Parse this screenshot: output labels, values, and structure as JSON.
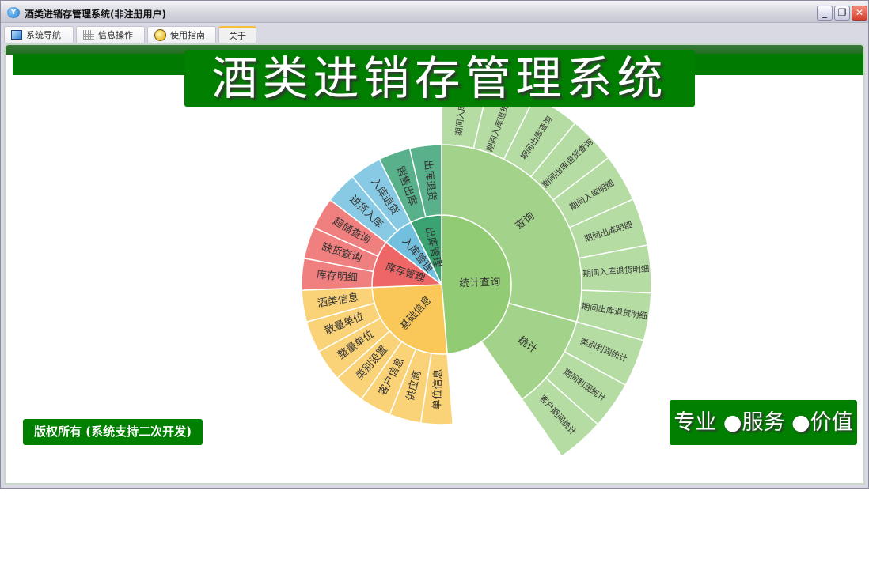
{
  "window": {
    "title": "酒类进销存管理系统(非注册用户)",
    "icon_text": "Y",
    "minimize": "_",
    "restore": "❐",
    "close": "✕"
  },
  "tabs": [
    {
      "label": "系统导航",
      "icon": "monitor-icon"
    },
    {
      "label": "信息操作",
      "icon": "grid-icon"
    },
    {
      "label": "使用指南",
      "icon": "help-icon"
    },
    {
      "label": "关于",
      "active": true
    }
  ],
  "banner": {
    "title": "酒类进销存管理系统"
  },
  "copyright": "版权所有 (系统支持二次开发)",
  "slogan": "专业 ●服务 ●价值",
  "colors": {
    "green": "#007f00"
  },
  "sunburst": [
    {
      "name": "统计查询",
      "extra": 2.3,
      "color": "#91cc75",
      "c2": "#a3d38a",
      "c3": "#b5dca3",
      "children": [
        {
          "name": "查询",
          "children": [
            "期间入库查询",
            "期间入库退货查询",
            "期间出库查询",
            "期间出库退货查询",
            "期间入库明细",
            "期间出库明细",
            "期间入库退货明细",
            "期间出库退货明细"
          ]
        },
        {
          "name": "统计",
          "children": [
            "类别利润统计",
            "期间利润统计",
            "客户期间统计"
          ]
        }
      ]
    },
    {
      "name": "基础信息",
      "color": "#f9c858",
      "c2": "#fad277",
      "children": [
        "单位信息",
        "供应商",
        "客户信息",
        "类别设置",
        "整量单位",
        "散量单位",
        "酒类信息"
      ]
    },
    {
      "name": "库存管理",
      "color": "#ee6666",
      "c2": "#f07f7f",
      "children": [
        "库存明细",
        "缺货查询",
        "超储查询"
      ]
    },
    {
      "name": "入库管理",
      "color": "#73c0de",
      "c2": "#88cae4",
      "children": [
        "进货入库",
        "入库退货"
      ]
    },
    {
      "name": "出库管理",
      "color": "#3ba272",
      "c2": "#58b18a",
      "children": [
        "销售出库",
        "出库退货"
      ]
    }
  ]
}
